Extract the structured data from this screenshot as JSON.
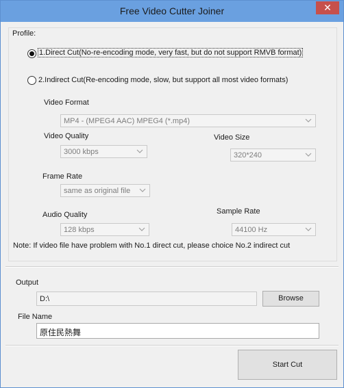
{
  "window": {
    "title": "Free Video Cutter Joiner",
    "close_glyph": "✕"
  },
  "profile": {
    "label": "Profile:",
    "option1": "1.Direct Cut(No-re-encoding mode, very fast, but do not support RMVB format)",
    "option2": "2.Indirect Cut(Re-encoding mode, slow, but support all most video formats)",
    "selected": 1
  },
  "video_format": {
    "label": "Video Format",
    "value": "MP4 - (MPEG4 AAC) MPEG4 (*.mp4)"
  },
  "video_quality": {
    "label": "Video Quality",
    "value": "3000 kbps"
  },
  "video_size": {
    "label": "Video Size",
    "value": "320*240"
  },
  "frame_rate": {
    "label": "Frame Rate",
    "value": "same as original file"
  },
  "audio_quality": {
    "label": "Audio Quality",
    "value": "128 kbps"
  },
  "sample_rate": {
    "label": "Sample Rate",
    "value": "44100 Hz"
  },
  "note": "Note: If video file have problem with No.1 direct cut, please choice No.2 indirect cut",
  "output": {
    "label": "Output",
    "path": "D:\\",
    "browse_label": "Browse"
  },
  "file_name": {
    "label": "File Name",
    "value": "原住民熱舞"
  },
  "start_cut_label": "Start Cut",
  "colors": {
    "titlebar": "#6aa0e0",
    "close": "#c7504b",
    "window_bg": "#f0f0f0"
  }
}
